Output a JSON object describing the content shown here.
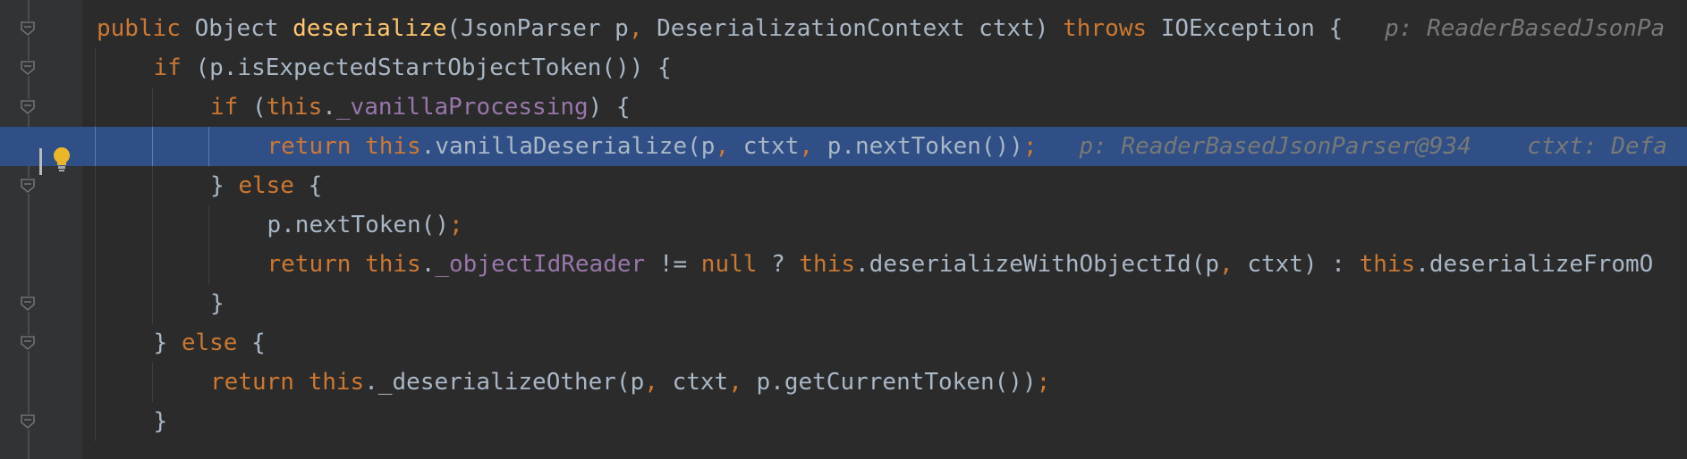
{
  "editor": {
    "lines": [
      {
        "tokens": [
          {
            "t": "public ",
            "c": "kw"
          },
          {
            "t": "Object ",
            "c": ""
          },
          {
            "t": "deserialize",
            "c": "fn"
          },
          {
            "t": "(JsonParser p",
            "c": ""
          },
          {
            "t": ", ",
            "c": "punc"
          },
          {
            "t": "DeserializationContext ctxt) ",
            "c": ""
          },
          {
            "t": "throws ",
            "c": "kw"
          },
          {
            "t": "IOException {",
            "c": ""
          },
          {
            "t": "   p: ReaderBasedJsonPa",
            "c": "hint"
          }
        ]
      },
      {
        "tokens": [
          {
            "t": "if ",
            "c": "kw"
          },
          {
            "t": "(p.isExpectedStartObjectToken()) {",
            "c": ""
          }
        ]
      },
      {
        "tokens": [
          {
            "t": "if ",
            "c": "kw"
          },
          {
            "t": "(",
            "c": ""
          },
          {
            "t": "this",
            "c": "kw"
          },
          {
            "t": ".",
            "c": ""
          },
          {
            "t": "_vanillaProcessing",
            "c": "field"
          },
          {
            "t": ") {",
            "c": ""
          }
        ]
      },
      {
        "tokens": [
          {
            "t": "return ",
            "c": "kw"
          },
          {
            "t": "this",
            "c": "kw"
          },
          {
            "t": ".vanillaDeserialize(p",
            "c": ""
          },
          {
            "t": ", ",
            "c": "punc"
          },
          {
            "t": "ctxt",
            "c": ""
          },
          {
            "t": ", ",
            "c": "punc"
          },
          {
            "t": "p.nextToken())",
            "c": ""
          },
          {
            "t": ";",
            "c": "punc"
          },
          {
            "t": "   p: ReaderBasedJsonParser@934    ctxt: Defa",
            "c": "hint"
          }
        ]
      },
      {
        "tokens": [
          {
            "t": "} ",
            "c": ""
          },
          {
            "t": "else ",
            "c": "kw"
          },
          {
            "t": "{",
            "c": ""
          }
        ]
      },
      {
        "tokens": [
          {
            "t": "p.nextToken()",
            "c": ""
          },
          {
            "t": ";",
            "c": "punc"
          }
        ]
      },
      {
        "tokens": [
          {
            "t": "return ",
            "c": "kw"
          },
          {
            "t": "this",
            "c": "kw"
          },
          {
            "t": ".",
            "c": ""
          },
          {
            "t": "_objectIdReader",
            "c": "field"
          },
          {
            "t": " != ",
            "c": ""
          },
          {
            "t": "null",
            "c": "kw"
          },
          {
            "t": " ? ",
            "c": ""
          },
          {
            "t": "this",
            "c": "kw"
          },
          {
            "t": ".deserializeWithObjectId(p",
            "c": ""
          },
          {
            "t": ", ",
            "c": "punc"
          },
          {
            "t": "ctxt) : ",
            "c": ""
          },
          {
            "t": "this",
            "c": "kw"
          },
          {
            "t": ".deserializeFromO",
            "c": ""
          }
        ]
      },
      {
        "tokens": [
          {
            "t": "}",
            "c": ""
          }
        ]
      },
      {
        "tokens": [
          {
            "t": "} ",
            "c": ""
          },
          {
            "t": "else ",
            "c": "kw"
          },
          {
            "t": "{",
            "c": ""
          }
        ]
      },
      {
        "tokens": [
          {
            "t": "return ",
            "c": "kw"
          },
          {
            "t": "this",
            "c": "kw"
          },
          {
            "t": "._deserializeOther(p",
            "c": ""
          },
          {
            "t": ", ",
            "c": "punc"
          },
          {
            "t": "ctxt",
            "c": ""
          },
          {
            "t": ", ",
            "c": "punc"
          },
          {
            "t": "p.getCurrentToken())",
            "c": ""
          },
          {
            "t": ";",
            "c": "punc"
          }
        ]
      },
      {
        "tokens": [
          {
            "t": "}",
            "c": ""
          }
        ]
      }
    ]
  },
  "colors": {
    "background": "#2b2b2b",
    "gutter": "#313335",
    "highlight": "#2f4f86",
    "keyword": "#cc7832",
    "function": "#ffc66d",
    "field": "#9876aa",
    "text": "#a9b7c6",
    "hint": "#787878",
    "bulb": "#e8b82a"
  },
  "icons": {
    "fold": "fold-marker-icon",
    "bulb": "lightbulb-icon"
  }
}
